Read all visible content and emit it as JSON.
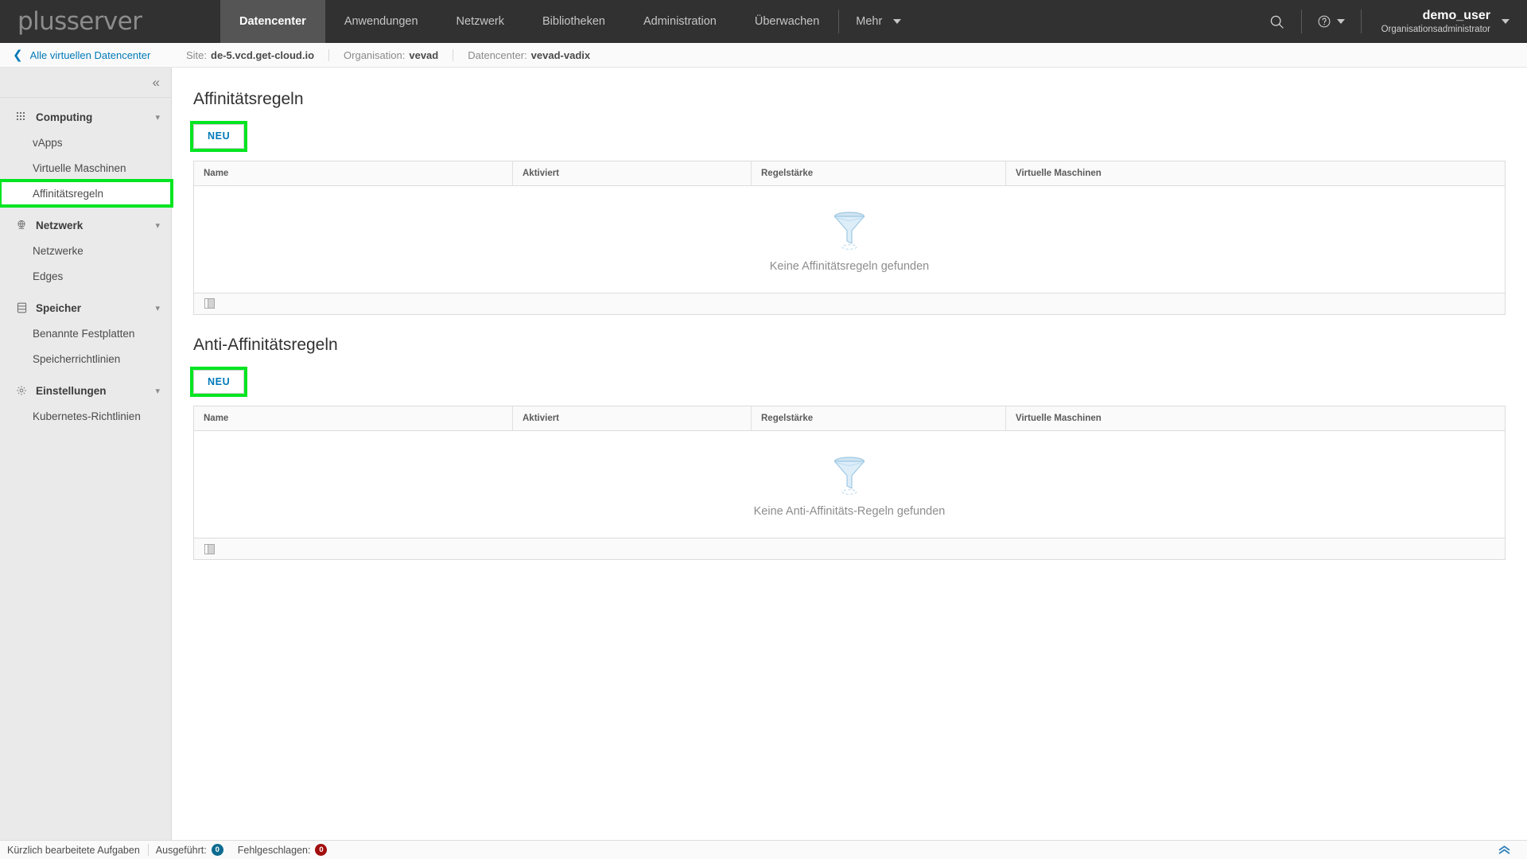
{
  "topnav": {
    "brand": "plusserver",
    "items": [
      {
        "label": "Datencenter",
        "active": true
      },
      {
        "label": "Anwendungen",
        "active": false
      },
      {
        "label": "Netzwerk",
        "active": false
      },
      {
        "label": "Bibliotheken",
        "active": false
      },
      {
        "label": "Administration",
        "active": false
      },
      {
        "label": "Überwachen",
        "active": false
      }
    ],
    "more_label": "Mehr",
    "search_icon": "search-icon",
    "help_icon": "help-circle-icon",
    "user_name": "demo_user",
    "user_role": "Organisationsadministrator"
  },
  "breadcrumb": {
    "back_label": "Alle virtuellen Datencenter",
    "segments": [
      {
        "label": "Site:",
        "value": "de-5.vcd.get-cloud.io"
      },
      {
        "label": "Organisation:",
        "value": "vevad"
      },
      {
        "label": "Datencenter:",
        "value": "vevad-vadix"
      }
    ]
  },
  "sidebar": {
    "collapse_icon": "chevron-double-left-icon",
    "groups": [
      {
        "label": "Computing",
        "icon": "grid-dots-icon",
        "links": [
          {
            "label": "vApps",
            "highlight": false
          },
          {
            "label": "Virtuelle Maschinen",
            "highlight": false
          },
          {
            "label": "Affinitätsregeln",
            "highlight": true
          }
        ]
      },
      {
        "label": "Netzwerk",
        "icon": "network-globe-icon",
        "links": [
          {
            "label": "Netzwerke",
            "highlight": false
          },
          {
            "label": "Edges",
            "highlight": false
          }
        ]
      },
      {
        "label": "Speicher",
        "icon": "database-icon",
        "links": [
          {
            "label": "Benannte Festplatten",
            "highlight": false
          },
          {
            "label": "Speicherrichtlinien",
            "highlight": false
          }
        ]
      },
      {
        "label": "Einstellungen",
        "icon": "gear-icon",
        "links": [
          {
            "label": "Kubernetes-Richtlinien",
            "highlight": false
          }
        ]
      }
    ]
  },
  "main": {
    "sections": [
      {
        "title": "Affinitätsregeln",
        "new_button": "NEU",
        "new_button_highlight": true,
        "columns": [
          "Name",
          "Aktiviert",
          "Regelstärke",
          "Virtuelle Maschinen"
        ],
        "rows": [],
        "empty_message": "Keine Affinitätsregeln gefunden",
        "empty_icon": "funnel-empty-icon",
        "footer_icon": "column-picker-icon"
      },
      {
        "title": "Anti-Affinitätsregeln",
        "new_button": "NEU",
        "new_button_highlight": true,
        "columns": [
          "Name",
          "Aktiviert",
          "Regelstärke",
          "Virtuelle Maschinen"
        ],
        "rows": [],
        "empty_message": "Keine Anti-Affinitäts-Regeln gefunden",
        "empty_icon": "funnel-empty-icon",
        "footer_icon": "column-picker-icon"
      }
    ]
  },
  "statusbar": {
    "label": "Kürzlich bearbeitete Aufgaben",
    "succeeded_label": "Ausgeführt:",
    "succeeded_count": "0",
    "failed_label": "Fehlgeschlagen:",
    "failed_count": "0",
    "expand_icon": "chevron-double-up-icon"
  },
  "colors": {
    "highlight": "#00e520",
    "accent_link": "#0079b8",
    "nav_bg": "#313131",
    "nav_active_bg": "#555555"
  }
}
